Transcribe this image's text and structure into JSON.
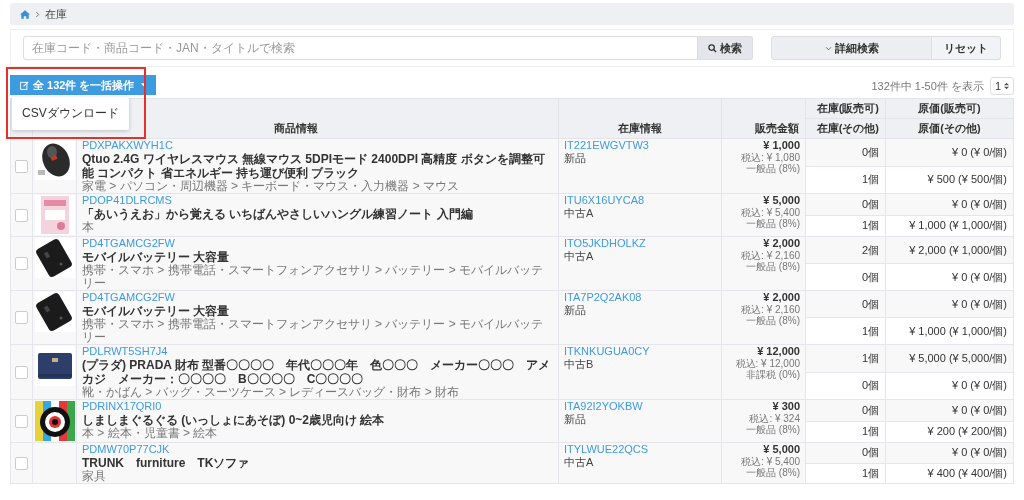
{
  "breadcrumb": {
    "current": "在庫"
  },
  "search": {
    "placeholder": "在庫コード・商品コード・JAN・タイトルで検索",
    "button": "検索",
    "advanced": "詳細検索",
    "reset": "リセット"
  },
  "bulk": {
    "label": "全 132件 を一括操作",
    "menu": [
      "CSVダウンロード"
    ]
  },
  "pagination": {
    "summary": "132件中 1-50件 を表示",
    "page": "1"
  },
  "table": {
    "headers": {
      "product": "商品情報",
      "stock": "在庫情報",
      "price": "販売金額",
      "qty_sellable": "在庫(販売可)",
      "qty_other": "在庫(その他)",
      "cost_sellable": "原価(販売可)",
      "cost_other": "原価(その他)"
    },
    "rows": [
      {
        "checked": false,
        "picture": true,
        "code": "PDXPAKXWYH1C",
        "title": "Qtuo 2.4G ワイヤレスマウス 無線マウス 5DPIモード 2400DPI 高精度 ボタンを調整可能 コンパクト 省エネルギー 持ち運び便利 ブラック",
        "category": "家電 > パソコン・周辺機器 > キーボード・マウス・入力機器 > マウス",
        "stock_code": "IT221EWGVTW3",
        "condition": "新品",
        "price": "¥ 1,000",
        "tax_incl": "税込: ¥ 1,080",
        "tax_class": "一般品 (8%)",
        "qty_sellable": "0個",
        "cost_sellable": "¥ 0 (¥ 0/個)",
        "qty_other": "1個",
        "cost_other": "¥ 500 (¥ 500/個)"
      },
      {
        "checked": false,
        "picture": true,
        "code": "PDOP41DLRCMS",
        "title": "「あいうえお」から覚える いちばんやさしいハングル練習ノート 入門編",
        "category": "本",
        "stock_code": "ITU6X16UYCA8",
        "condition": "中古A",
        "price": "¥ 5,000",
        "tax_incl": "税込: ¥ 5,400",
        "tax_class": "一般品 (8%)",
        "qty_sellable": "0個",
        "cost_sellable": "¥ 0 (¥ 0/個)",
        "qty_other": "1個",
        "cost_other": "¥ 1,000 (¥ 1,000/個)"
      },
      {
        "checked": false,
        "picture": true,
        "code": "PD4TGAMCG2FW",
        "title": "モバイルバッテリー 大容量",
        "category": "携帯・スマホ > 携帯電話・スマートフォンアクセサリ > バッテリー > モバイルバッテリー",
        "stock_code": "ITO5JKDHOLKZ",
        "condition": "中古A",
        "price": "¥ 2,000",
        "tax_incl": "税込: ¥ 2,160",
        "tax_class": "一般品 (8%)",
        "qty_sellable": "2個",
        "cost_sellable": "¥ 2,000 (¥ 1,000/個)",
        "qty_other": "0個",
        "cost_other": "¥ 0 (¥ 0/個)"
      },
      {
        "checked": false,
        "picture": true,
        "code": "PD4TGAMCG2FW",
        "title": "モバイルバッテリー 大容量",
        "category": "携帯・スマホ > 携帯電話・スマートフォンアクセサリ > バッテリー > モバイルバッテリー",
        "stock_code": "ITA7P2Q2AK08",
        "condition": "新品",
        "price": "¥ 2,000",
        "tax_incl": "税込: ¥ 2,160",
        "tax_class": "一般品 (8%)",
        "qty_sellable": "0個",
        "cost_sellable": "¥ 0 (¥ 0/個)",
        "qty_other": "1個",
        "cost_other": "¥ 1,000 (¥ 1,000/個)"
      },
      {
        "checked": false,
        "picture": true,
        "code": "PDLRWT5SH7J4",
        "title": "(プラダ) PRADA 財布 型番〇〇〇〇　年代〇〇〇年　色〇〇〇　メーカー〇〇〇　アメカジ　メーカー：〇〇〇〇　B〇〇〇〇　C〇〇〇〇",
        "category": "靴・かばん > バッグ・スーツケース > レディースバッグ・財布 > 財布",
        "stock_code": "ITKNKUGUA0CY",
        "condition": "中古B",
        "price": "¥ 12,000",
        "tax_incl": "税込: ¥ 12,000",
        "tax_class": "非課税 (0%)",
        "qty_sellable": "1個",
        "cost_sellable": "¥ 5,000 (¥ 5,000/個)",
        "qty_other": "0個",
        "cost_other": "¥ 0 (¥ 0/個)"
      },
      {
        "checked": false,
        "picture": true,
        "code": "PDRINX17QRI0",
        "title": "しましまぐるぐる (いっしょにあそぼ) 0~2歳児向け 絵本",
        "category": "本 > 絵本・児童書 > 絵本",
        "stock_code": "ITA92I2YOKBW",
        "condition": "新品",
        "price": "¥ 300",
        "tax_incl": "税込: ¥ 324",
        "tax_class": "一般品 (8%)",
        "qty_sellable": "0個",
        "cost_sellable": "¥ 0 (¥ 0/個)",
        "qty_other": "1個",
        "cost_other": "¥ 200 (¥ 200/個)"
      },
      {
        "checked": false,
        "picture": false,
        "code": "PDMW70P77CJK",
        "title": "TRUNK　furniture　TKソファ",
        "category": "家具",
        "stock_code": "ITYLWUE22QCS",
        "condition": "中古A",
        "price": "¥ 5,000",
        "tax_incl": "税込: ¥ 5,400",
        "tax_class": "一般品 (8%)",
        "qty_sellable": "0個",
        "cost_sellable": "¥ 0 (¥ 0/個)",
        "qty_other": "1個",
        "cost_other": "¥ 400 (¥ 400/個)"
      }
    ]
  }
}
